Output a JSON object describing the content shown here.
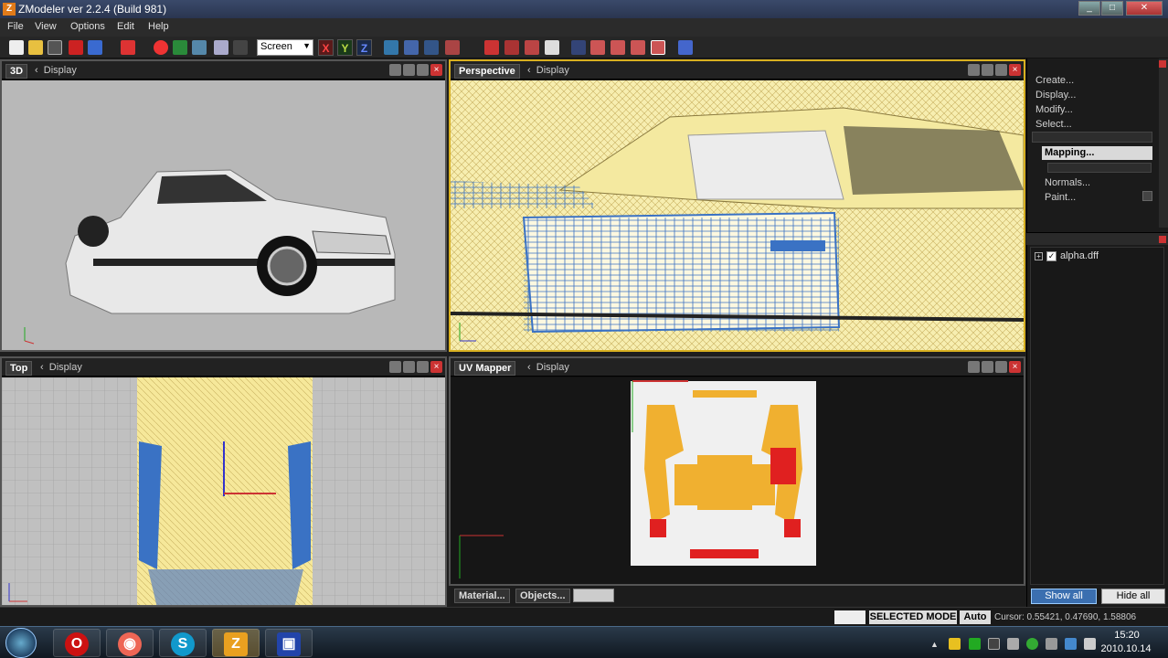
{
  "window": {
    "title": "ZModeler ver 2.2.4 (Build 981)",
    "app_letter": "Z",
    "min": "_",
    "max": "□",
    "close": "✕"
  },
  "menu": [
    "File",
    "View",
    "Options",
    "Edit",
    "Help"
  ],
  "toolbar": {
    "screen_select": "Screen",
    "axis_x": "X",
    "axis_y": "Y",
    "axis_z": "Z"
  },
  "viewports": {
    "vp3d": {
      "label": "3D",
      "display": "Display"
    },
    "perspective": {
      "label": "Perspective",
      "display": "Display"
    },
    "top": {
      "label": "Top",
      "display": "Display"
    },
    "uvmapper": {
      "label": "UV Mapper",
      "display": "Display"
    }
  },
  "right_panel": {
    "commands": [
      "Create...",
      "Display...",
      "Modify...",
      "Select..."
    ],
    "mapping": "Mapping...",
    "commands2": [
      "Normals...",
      "Paint..."
    ],
    "tree_item": "alpha.dff",
    "show_all": "Show all",
    "hide_all": "Hide all"
  },
  "bottom_tabs": {
    "material": "Material...",
    "objects": "Objects..."
  },
  "status": {
    "mode": "SELECTED MODE",
    "auto": "Auto",
    "cursor": "Cursor: 0.55421, 0.47690, 1.58806"
  },
  "taskbar": {
    "apps": [
      "start-orb",
      "opera",
      "firefox",
      "skype",
      "zmodeler",
      "app"
    ],
    "time": "15:20",
    "date": "2010.10.14"
  },
  "colors": {
    "wire_yellow": "#f5e79a",
    "wire_blue": "#3a72c4",
    "uv_orange": "#f0b030",
    "uv_red": "#e02020"
  }
}
